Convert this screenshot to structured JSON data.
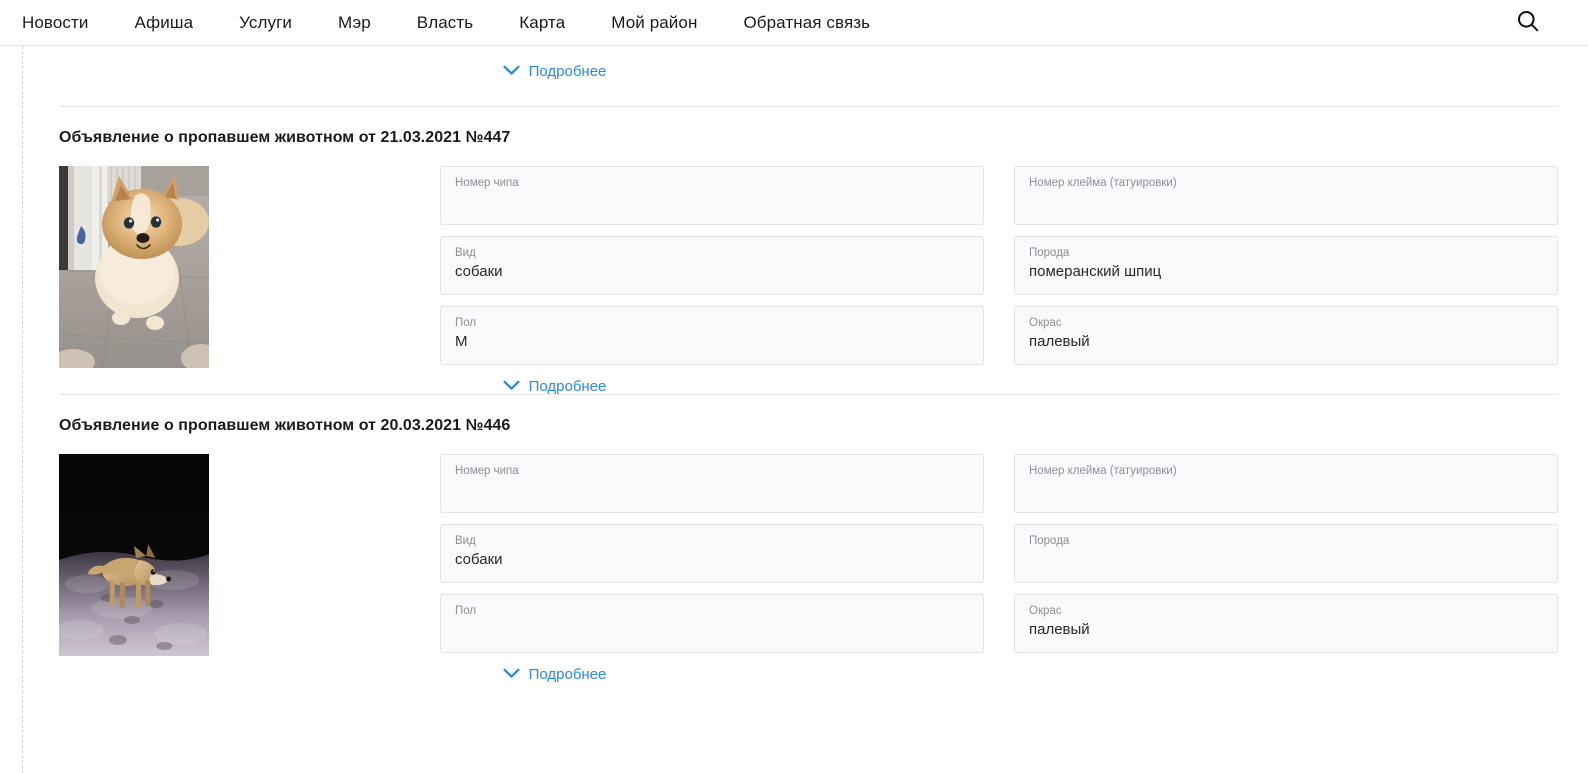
{
  "nav": {
    "items": [
      {
        "label": "Новости"
      },
      {
        "label": "Афиша"
      },
      {
        "label": "Услуги"
      },
      {
        "label": "Мэр"
      },
      {
        "label": "Власть"
      },
      {
        "label": "Карта"
      },
      {
        "label": "Мой район"
      },
      {
        "label": "Обратная связь"
      }
    ],
    "search_icon": "search-icon"
  },
  "colors": {
    "link_blue": "#2b8ae0",
    "field_bg": "#f9fafc",
    "field_border": "#dfe3e8",
    "label_gray": "#8b8f96",
    "divider": "#e6e6e6"
  },
  "common": {
    "more_label": "Подробнее",
    "chevron_icon": "chevron-down-icon"
  },
  "top_partial": {
    "more_label": "Подробнее"
  },
  "cards": [
    {
      "title": "Объявление о пропавшем животном от 21.03.2021 №447",
      "date": "21.03.2021",
      "number": "№447",
      "photo": {
        "alt": "померанский шпиц на сером кафельном полу",
        "variant": "spitz"
      },
      "fields": [
        {
          "label": "Номер чипа",
          "value": ""
        },
        {
          "label": "Номер клейма (татуировки)",
          "value": ""
        },
        {
          "label": "Вид",
          "value": "собаки"
        },
        {
          "label": "Порода",
          "value": "померанский шпиц"
        },
        {
          "label": "Пол",
          "value": "М"
        },
        {
          "label": "Окрас",
          "value": "палевый"
        }
      ],
      "more_label": "Подробнее"
    },
    {
      "title": "Объявление о пропавшем животном от 20.03.2021 №446",
      "date": "20.03.2021",
      "number": "№446",
      "photo": {
        "alt": "собака палевого окраса на снегу ночью",
        "variant": "night"
      },
      "fields": [
        {
          "label": "Номер чипа",
          "value": ""
        },
        {
          "label": "Номер клейма (татуировки)",
          "value": ""
        },
        {
          "label": "Вид",
          "value": "собаки"
        },
        {
          "label": "Порода",
          "value": ""
        },
        {
          "label": "Пол",
          "value": ""
        },
        {
          "label": "Окрас",
          "value": "палевый"
        }
      ],
      "more_label": "Подробнее"
    }
  ]
}
